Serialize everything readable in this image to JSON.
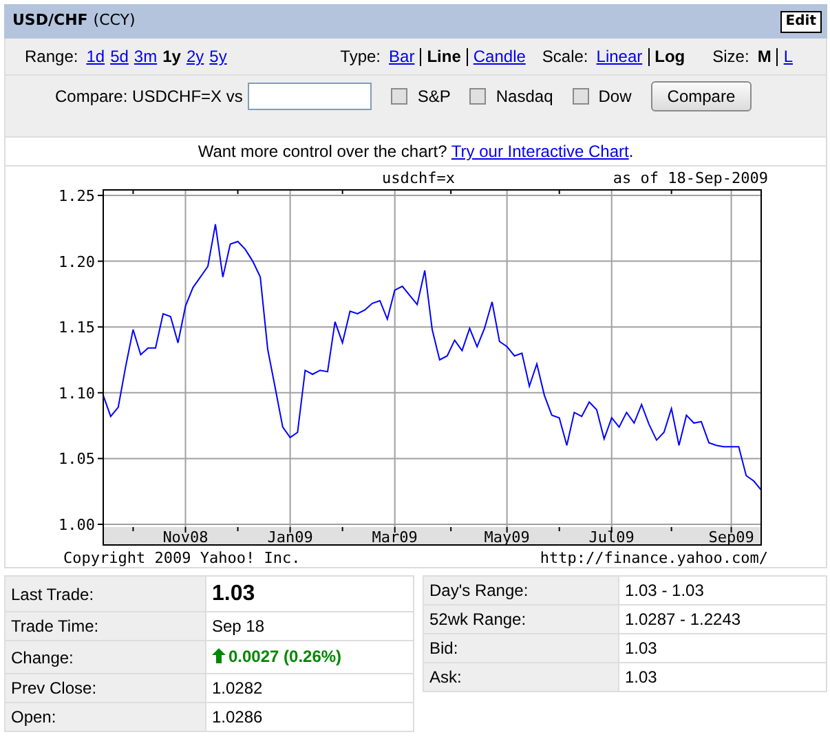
{
  "header": {
    "title": "USD/CHF",
    "subtitle": "(CCY)",
    "edit_button": "Edit"
  },
  "controls": {
    "range": {
      "label": "Range:",
      "options": [
        {
          "label": "1d",
          "selected": false
        },
        {
          "label": "5d",
          "selected": false
        },
        {
          "label": "3m",
          "selected": false
        },
        {
          "label": "1y",
          "selected": true
        },
        {
          "label": "2y",
          "selected": false
        },
        {
          "label": "5y",
          "selected": false
        }
      ]
    },
    "type": {
      "label": "Type:",
      "options": [
        {
          "label": "Bar",
          "selected": false
        },
        {
          "label": "Line",
          "selected": true
        },
        {
          "label": "Candle",
          "selected": false
        }
      ]
    },
    "scale": {
      "label": "Scale:",
      "options": [
        {
          "label": "Linear",
          "selected": false
        },
        {
          "label": "Log",
          "selected": true
        }
      ]
    },
    "size": {
      "label": "Size:",
      "options": [
        {
          "label": "M",
          "selected": true
        },
        {
          "label": "L",
          "selected": false
        }
      ]
    }
  },
  "compare": {
    "label": "Compare: USDCHF=X vs",
    "checkboxes": [
      {
        "label": "S&P",
        "checked": false
      },
      {
        "label": "Nasdaq",
        "checked": false
      },
      {
        "label": "Dow",
        "checked": false
      }
    ],
    "button": "Compare"
  },
  "promo": {
    "text": "Want more control over the chart?",
    "link": "Try our Interactive Chart",
    "tail": "."
  },
  "chart": {
    "as_of": "as of 18-Sep-2009",
    "copyright": "Copyright 2009 Yahoo! Inc.",
    "url": "http://finance.yahoo.com/",
    "chart_data": {
      "type": "line",
      "title": "usdchf=x",
      "grid": true,
      "ylim": [
        1.0,
        1.25
      ],
      "categories": [
        null,
        null,
        null,
        null,
        null,
        null,
        null,
        null,
        null,
        null,
        null,
        "Nov08",
        null,
        null,
        null,
        null,
        null,
        null,
        null,
        null,
        null,
        null,
        null,
        null,
        null,
        "Jan09",
        null,
        null,
        null,
        null,
        null,
        null,
        null,
        null,
        null,
        null,
        null,
        null,
        null,
        "Mar09",
        null,
        null,
        null,
        null,
        null,
        null,
        null,
        null,
        null,
        null,
        null,
        null,
        null,
        null,
        "May09",
        null,
        null,
        null,
        null,
        null,
        null,
        null,
        null,
        null,
        null,
        null,
        null,
        null,
        "Jul09",
        null,
        null,
        null,
        null,
        null,
        null,
        null,
        null,
        null,
        null,
        null,
        null,
        null,
        null,
        null,
        "Sep09",
        null,
        null,
        null,
        null
      ],
      "yticks": [
        {
          "value": 1.0,
          "label": "1.00"
        },
        {
          "value": 1.05,
          "label": "1.05"
        },
        {
          "value": 1.1,
          "label": "1.10"
        },
        {
          "value": 1.15,
          "label": "1.15"
        },
        {
          "value": 1.2,
          "label": "1.20"
        },
        {
          "value": 1.25,
          "label": "1.25"
        }
      ],
      "series": [
        {
          "color": "#0000ff",
          "values": [
            1.098,
            1.082,
            1.089,
            1.12,
            1.148,
            1.129,
            1.134,
            1.134,
            1.16,
            1.158,
            1.138,
            1.166,
            1.18,
            1.188,
            1.196,
            1.228,
            1.188,
            1.213,
            1.215,
            1.209,
            1.2,
            1.188,
            1.133,
            1.104,
            1.074,
            1.066,
            1.07,
            1.117,
            1.114,
            1.117,
            1.116,
            1.154,
            1.138,
            1.162,
            1.16,
            1.163,
            1.168,
            1.17,
            1.156,
            1.178,
            1.181,
            1.174,
            1.167,
            1.193,
            1.148,
            1.125,
            1.128,
            1.14,
            1.132,
            1.149,
            1.135,
            1.149,
            1.169,
            1.139,
            1.135,
            1.128,
            1.13,
            1.105,
            1.122,
            1.098,
            1.083,
            1.081,
            1.06,
            1.085,
            1.082,
            1.093,
            1.087,
            1.065,
            1.081,
            1.074,
            1.085,
            1.077,
            1.091,
            1.076,
            1.064,
            1.07,
            1.088,
            1.06,
            1.083,
            1.077,
            1.078,
            1.062,
            1.06,
            1.059,
            1.059,
            1.059,
            1.037,
            1.033,
            1.026
          ]
        }
      ]
    }
  },
  "quote_left": [
    {
      "kind": "price",
      "label": "Last Trade:",
      "value": "1.03"
    },
    {
      "kind": "plain",
      "label": "Trade Time:",
      "value": "Sep 18"
    },
    {
      "kind": "change_up",
      "label": "Change:",
      "value": "0.0027 (0.26%)"
    },
    {
      "kind": "plain",
      "label": "Prev Close:",
      "value": "1.0282"
    },
    {
      "kind": "plain",
      "label": "Open:",
      "value": "1.0286"
    }
  ],
  "quote_right": [
    {
      "kind": "plain",
      "label": "Day's Range:",
      "value": "1.03 - 1.03"
    },
    {
      "kind": "plain",
      "label": "52wk Range:",
      "value": "1.0287 - 1.2243"
    },
    {
      "kind": "plain",
      "label": "Bid:",
      "value": "1.03"
    },
    {
      "kind": "plain",
      "label": "Ask:",
      "value": "1.03"
    }
  ]
}
